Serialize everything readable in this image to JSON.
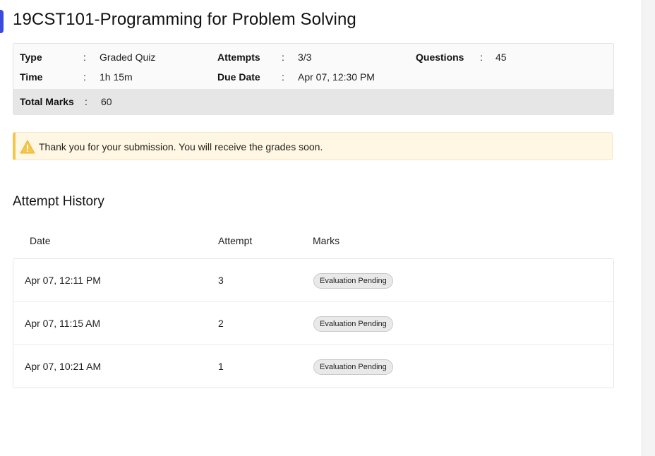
{
  "page": {
    "title": "19CST101-Programming for Problem Solving"
  },
  "info": {
    "colon": ":",
    "type_label": "Type",
    "type_value": "Graded Quiz",
    "attempts_label": "Attempts",
    "attempts_value": "3/3",
    "questions_label": "Questions",
    "questions_value": "45",
    "time_label": "Time",
    "time_value": "1h 15m",
    "due_label": "Due Date",
    "due_value": "Apr 07, 12:30 PM",
    "total_label": "Total Marks",
    "total_value": "60"
  },
  "notice": {
    "icon": "warning-icon",
    "message": "Thank you for your submission. You will receive the grades soon.",
    "accent_color": "#f4c64a"
  },
  "history": {
    "title": "Attempt History",
    "columns": [
      "Date",
      "Attempt",
      "Marks"
    ],
    "rows": [
      {
        "date": "Apr 07, 12:11 PM",
        "attempt": "3",
        "marks": "Evaluation Pending"
      },
      {
        "date": "Apr 07, 11:15 AM",
        "attempt": "2",
        "marks": "Evaluation Pending"
      },
      {
        "date": "Apr 07, 10:21 AM",
        "attempt": "1",
        "marks": "Evaluation Pending"
      }
    ]
  },
  "colors": {
    "accent": "#3b49df",
    "badge_bg": "#e9e9e9",
    "total_row_bg": "#e6e6e6"
  }
}
